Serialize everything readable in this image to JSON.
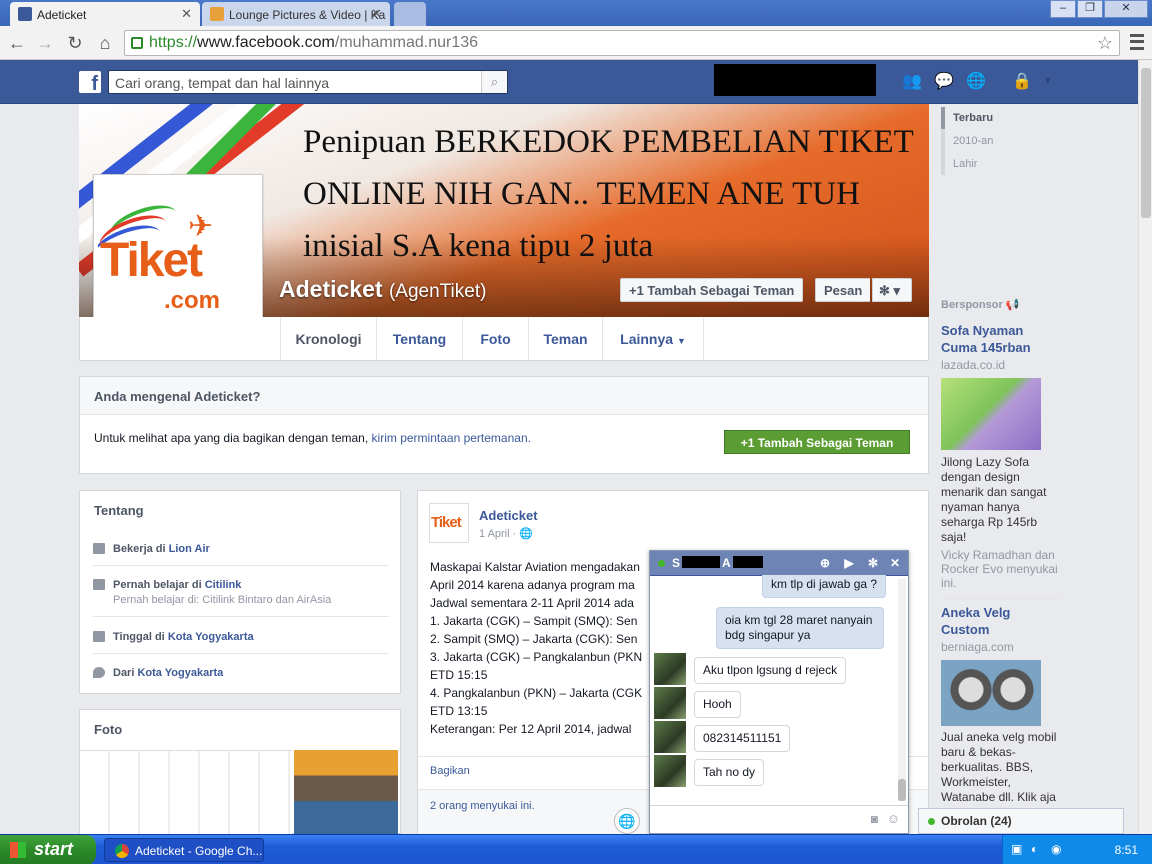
{
  "browser": {
    "tabs": [
      {
        "label": "Adeticket"
      },
      {
        "label": "Lounge Pictures & Video | Ka"
      }
    ],
    "url": {
      "scheme": "https://",
      "host": "www.facebook.com",
      "path": "/muhammad.nur136"
    }
  },
  "fb": {
    "search_placeholder": "Cari orang, tempat dan hal lainnya"
  },
  "cover": {
    "headline": "Penipuan BERKEDOK PEMBELIAN TIKET ONLINE NIH GAN.. TEMEN ANE TUH inisial S.A kena tipu 2 juta"
  },
  "profile": {
    "name": "Adeticket",
    "alt_name": "(AgenTiket)",
    "add_friend": "+1 Tambah Sebagai Teman",
    "message": "Pesan",
    "logo_text": "Tiket",
    "logo_suffix": ".com"
  },
  "timeline_nav": [
    "Kronologi",
    "Tentang",
    "Foto",
    "Teman",
    "Lainnya"
  ],
  "years": [
    "Terbaru",
    "2010-an",
    "Lahir"
  ],
  "know": {
    "title": "Anda mengenal Adeticket?",
    "text": "Untuk melihat apa yang dia bagikan dengan teman,",
    "link": "kirim permintaan pertemanan.",
    "button": "+1 Tambah Sebagai Teman"
  },
  "about": {
    "title": "Tentang",
    "items": [
      {
        "prefix": "Bekerja di",
        "value": "Lion Air",
        "sub": ""
      },
      {
        "prefix": "Pernah belajar di",
        "value": "Citilink",
        "sub": "Pernah belajar di: Citilink Bintaro dan AirAsia"
      },
      {
        "prefix": "Tinggal di",
        "value": "Kota Yogyakarta",
        "sub": ""
      },
      {
        "prefix": "Dari",
        "value": "Kota Yogyakarta",
        "sub": ""
      }
    ]
  },
  "photos": {
    "title": "Foto"
  },
  "post": {
    "author": "Adeticket",
    "date": "1 April",
    "lines": [
      "Maskapai Kalstar Aviation mengadakan",
      "April 2014 karena adanya program ma",
      "Jadwal sementara 2-11 April 2014 ada",
      "1. Jakarta (CGK) – Sampit (SMQ): Sen",
      "2. Sampit (SMQ) – Jakarta (CGK): Sen",
      "3. Jakarta (CGK) – Pangkalanbun (PKN",
      "ETD 15:15",
      "4. Pangkalanbun (PKN) – Jakarta (CGK",
      "ETD 13:15",
      "Keterangan: Per 12 April 2014, jadwal"
    ],
    "share": "Bagikan",
    "likes": "2 orang menyukai ini."
  },
  "ads": {
    "title": "Bersponsor",
    "items": [
      {
        "title": "Sofa Nyaman Cuma 145rban",
        "domain": "lazada.co.id",
        "body": "Jilong Lazy Sofa dengan design menarik dan sangat nyaman hanya seharga Rp 145rb saja!",
        "social": "Vicky Ramadhan dan Rocker Evo menyukai ini."
      },
      {
        "title": "Aneka Velg Custom",
        "domain": "berniaga.com",
        "body": "Jual aneka velg mobil baru & bekas-berkualitas. BBS, Workmeister, Watanabe dll. Klik aja"
      }
    ]
  },
  "chat": {
    "name_initial": "S",
    "name_mid": "A",
    "messages": [
      {
        "text": "km tlp di jawab ga ?",
        "from": "me"
      },
      {
        "text": "oia km tgl 28 maret nanyain bdg singapur ya",
        "from": "me"
      },
      {
        "text": "Aku tlpon lgsung d rejeck",
        "from": "them"
      },
      {
        "text": "Hooh",
        "from": "them"
      },
      {
        "text": "082314511151",
        "from": "them"
      },
      {
        "text": "Tah no dy",
        "from": "them"
      }
    ],
    "dock": "Obrolan (24)"
  },
  "taskbar": {
    "start": "start",
    "item": "Adeticket - Google Ch...",
    "clock": "8:51"
  },
  "colors": {
    "fb_blue": "#3b5998",
    "orange": "#e65e17",
    "green": "#5b9d33"
  }
}
